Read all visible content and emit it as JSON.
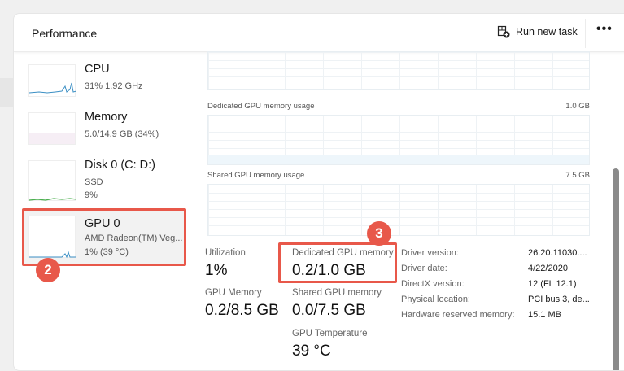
{
  "header": {
    "title": "Performance",
    "run_new_task": "Run new task",
    "more": "•••"
  },
  "sidebar": [
    {
      "name": "CPU",
      "sub": [
        "31%  1.92 GHz"
      ],
      "color": "#3b8fc4"
    },
    {
      "name": "Memory",
      "sub": [
        "5.0/14.9 GB (34%)"
      ],
      "color": "#a0408f"
    },
    {
      "name": "Disk 0 (C: D:)",
      "sub": [
        "SSD",
        "9%"
      ],
      "color": "#4caf50"
    },
    {
      "name": "GPU 0",
      "sub": [
        "AMD Radeon(TM) Veg...",
        "1% (39 °C)"
      ],
      "color": "#3b8fc4"
    }
  ],
  "badges": {
    "b2": "2",
    "b3": "3"
  },
  "graphs": {
    "dedicated_label": "Dedicated GPU memory usage",
    "dedicated_max": "1.0 GB",
    "shared_label": "Shared GPU memory usage",
    "shared_max": "7.5 GB"
  },
  "stats": {
    "utilization_label": "Utilization",
    "utilization": "1%",
    "dedicated_label": "Dedicated GPU memory",
    "dedicated": "0.2/1.0 GB",
    "gpu_memory_label": "GPU Memory",
    "gpu_memory": "0.2/8.5 GB",
    "shared_label": "Shared GPU memory",
    "shared": "0.0/7.5 GB",
    "temp_label": "GPU Temperature",
    "temp": "39 °C"
  },
  "details": [
    {
      "k": "Driver version:",
      "v": "26.20.11030...."
    },
    {
      "k": "Driver date:",
      "v": "4/22/2020"
    },
    {
      "k": "DirectX version:",
      "v": "12 (FL 12.1)"
    },
    {
      "k": "Physical location:",
      "v": "PCI bus 3, de..."
    },
    {
      "k": "Hardware reserved memory:",
      "v": "15.1 MB"
    }
  ]
}
